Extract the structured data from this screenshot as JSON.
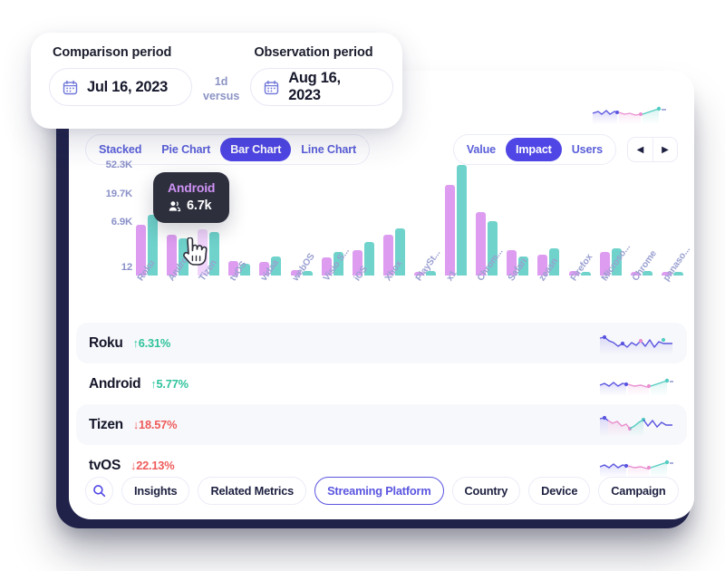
{
  "date_panel": {
    "comparison_label": "Comparison period",
    "comparison_date": "Jul 16, 2023",
    "versus_top": "1d",
    "versus_bottom": "versus",
    "observation_label": "Observation period",
    "observation_date": "Aug 16, 2023"
  },
  "toolbar": {
    "chart_types": [
      {
        "label": "Stacked",
        "active": false
      },
      {
        "label": "Pie Chart",
        "active": false
      },
      {
        "label": "Bar Chart",
        "active": true
      },
      {
        "label": "Line Chart",
        "active": false
      }
    ],
    "metrics": [
      {
        "label": "Value",
        "active": false
      },
      {
        "label": "Impact",
        "active": true
      },
      {
        "label": "Users",
        "active": false
      }
    ],
    "prev_arrow": "◀",
    "next_arrow": "▶"
  },
  "tooltip": {
    "title": "Android",
    "value": "6.7k",
    "icon": "people-icon"
  },
  "chart_data": {
    "type": "bar",
    "title": "",
    "xlabel": "",
    "ylabel": "",
    "scale": "log",
    "grid": false,
    "legend": null,
    "ytick_labels": [
      "52.3K",
      "19.7K",
      "6.9K",
      "12"
    ],
    "ytick_positions_pct": [
      100,
      74,
      48,
      7
    ],
    "categories": [
      "Roku",
      "Android",
      "Tizen",
      "tvOS",
      "vidaa",
      "webOS",
      "Visio S...",
      "iOS",
      "Xbox",
      "PlaySt...",
      "x1",
      "Chrom...",
      "Safari",
      "zeasn",
      "Firefox",
      "Microso...",
      "Chrome",
      "panaso..."
    ],
    "series": [
      {
        "name": "Comparison period",
        "color": "#dd9cf0",
        "values": [
          46,
          37,
          42,
          13,
          12,
          5,
          16,
          23,
          37,
          3,
          82,
          57,
          23,
          19,
          4,
          21,
          3,
          3
        ]
      },
      {
        "name": "Observation period",
        "color": "#6fd3cb",
        "values": [
          55,
          34,
          39,
          11,
          17,
          4,
          21,
          30,
          43,
          4,
          100,
          49,
          17,
          25,
          3,
          25,
          4,
          3
        ]
      }
    ],
    "highlighted_category": "Tizen",
    "highlight_color": "#f1d4fb"
  },
  "list": {
    "rows": [
      {
        "name": "Roku",
        "delta": "6.31%",
        "direction": "up"
      },
      {
        "name": "Android",
        "delta": "5.77%",
        "direction": "up"
      },
      {
        "name": "Tizen",
        "delta": "18.57%",
        "direction": "down"
      },
      {
        "name": "tvOS",
        "delta": "22.13%",
        "direction": "down"
      }
    ],
    "up_arrow": "↑",
    "down_arrow": "↓"
  },
  "filters": {
    "search_icon": "search-icon",
    "chips": [
      {
        "label": "Insights",
        "selected": false
      },
      {
        "label": "Related Metrics",
        "selected": false
      },
      {
        "label": "Streaming Platform",
        "selected": true
      },
      {
        "label": "Country",
        "selected": false
      },
      {
        "label": "Device",
        "selected": false
      },
      {
        "label": "Campaign",
        "selected": false
      }
    ]
  },
  "colors": {
    "accent": "#4f46e5",
    "bar_a": "#dd9cf0",
    "bar_b": "#6fd3cb",
    "up": "#2fc39c",
    "down": "#ef5b5b",
    "dark_card": "#20224a"
  }
}
